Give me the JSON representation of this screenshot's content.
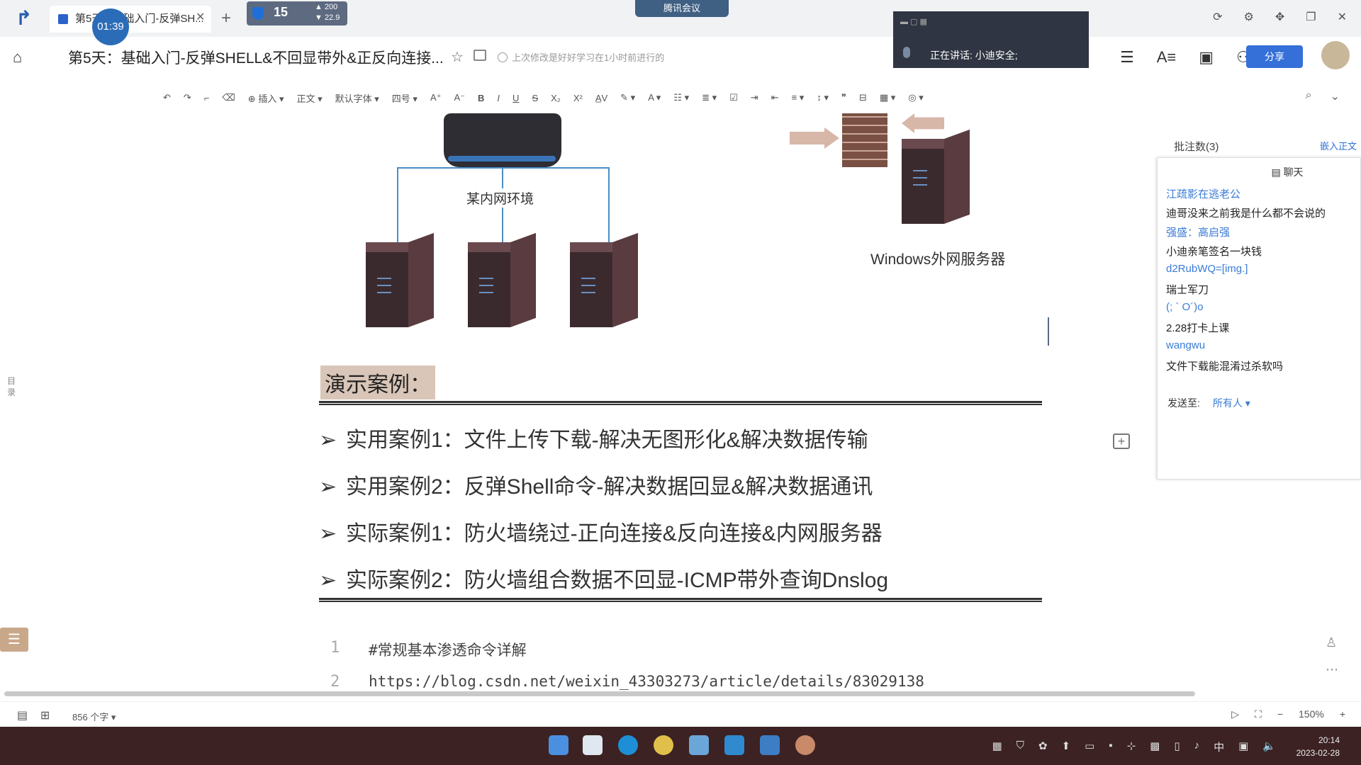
{
  "tabbar": {
    "doc_tab_title": "第5天：基础入门-反弹SH...",
    "timer": "01:39",
    "security_count": "15",
    "security_up": "▲ 200",
    "security_down": "▼ 22.9",
    "meeting_label": "腾讯会议"
  },
  "header": {
    "doc_title": "第5天：基础入门-反弹SHELL&不回显带外&正反向连接...",
    "save_status": "上次修改是好好学习在1小时前进行的",
    "share_label": "分享",
    "speaking_text": "正在讲话: 小迪安全;"
  },
  "toolbar": {
    "insert": "插入",
    "style": "正文",
    "font": "默认字体",
    "size": "四号"
  },
  "diagram": {
    "network_label": "某内网环境",
    "windows_server_label": "Windows外网服务器"
  },
  "toc_label": "目录",
  "demo": {
    "title": "演示案例：",
    "cases": [
      "实用案例1：文件上传下载-解决无图形化&解决数据传输",
      "实用案例2：反弹Shell命令-解决数据回显&解决数据通讯",
      "实际案例1：防火墙绕过-正向连接&反向连接&内网服务器",
      "实际案例2：防火墙组合数据不回显-ICMP带外查询Dnslog"
    ]
  },
  "code": {
    "lines": [
      {
        "num": "1",
        "text": "#常规基本渗透命令详解"
      },
      {
        "num": "2",
        "text": "https://blog.csdn.net/weixin_43303273/article/details/83029138"
      }
    ]
  },
  "comments": {
    "header": "批注数(3)",
    "embed": "嵌入正文",
    "chat_title": "聊天",
    "messages": [
      {
        "name": "江疏影在逃老公",
        "text": "迪哥没来之前我是什么都不会说的"
      },
      {
        "name": "强盛：高启强",
        "text": "小迪亲笔签名一块钱"
      },
      {
        "name": "d2RubWQ=[img.]",
        "text": "瑞士军刀"
      },
      {
        "name": "(; ` O´)o",
        "text": "2.28打卡上课"
      },
      {
        "name": "wangwu",
        "text": "文件下载能混淆过杀软吗"
      }
    ],
    "send_to_label": "发送至:",
    "send_to_value": "所有人 ▾"
  },
  "status": {
    "word_count": "856 个字 ▾",
    "zoom": "150%"
  },
  "taskbar": {
    "time": "20:14",
    "date": "2023-02-28",
    "ime": "中"
  }
}
